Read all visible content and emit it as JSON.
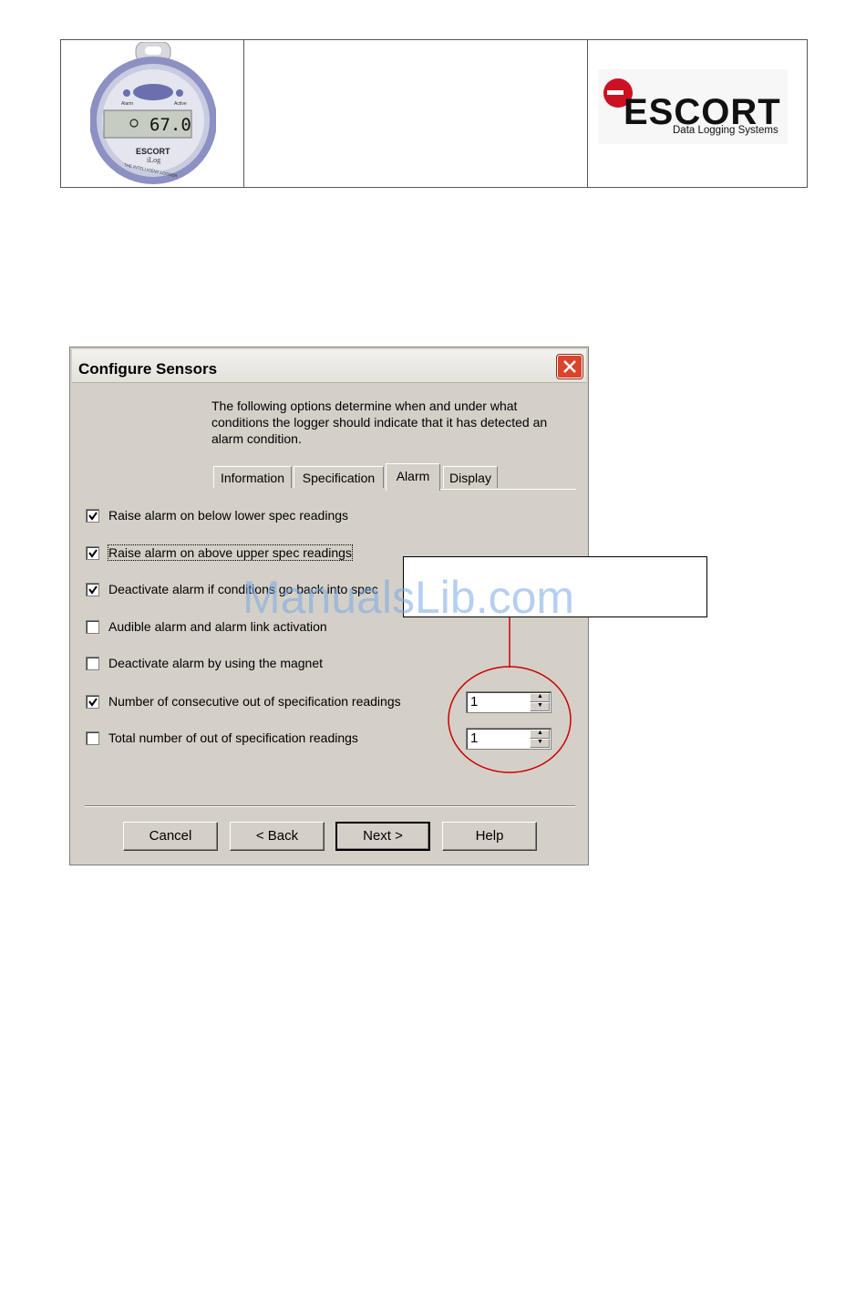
{
  "header": {
    "device_display": "67.0",
    "device_brand": "ESCORT",
    "device_model": "iLog",
    "device_tagline": "THE INTELLIGENT LOGGER",
    "device_led_left": "Alarm",
    "device_led_right": "Active",
    "logo_name": "ESCORT",
    "logo_subtitle": "Data Logging Systems"
  },
  "dialog": {
    "title": "Configure Sensors",
    "intro": "The following options determine when and under what conditions the logger should indicate that it has detected an alarm condition.",
    "tabs": [
      {
        "label": "Information",
        "active": false
      },
      {
        "label": "Specification",
        "active": false
      },
      {
        "label": "Alarm",
        "active": true
      },
      {
        "label": "Display",
        "active": false
      }
    ],
    "options": [
      {
        "label": "Raise alarm on below lower spec readings",
        "checked": true
      },
      {
        "label": "Raise alarm on above upper spec readings",
        "checked": true
      },
      {
        "label": "Deactivate alarm if conditions go back into spec",
        "checked": true
      },
      {
        "label": "Audible alarm and alarm link activation",
        "checked": false
      },
      {
        "label": "Deactivate alarm by using the magnet",
        "checked": false
      },
      {
        "label": "Number of consecutive out of specification readings",
        "checked": true
      },
      {
        "label": "Total number of out of specification readings",
        "checked": false
      }
    ],
    "consecutive_value": "1",
    "total_value": "1",
    "buttons": {
      "cancel": "Cancel",
      "back": "< Back",
      "next": "Next >",
      "help": "Help"
    }
  },
  "watermark": "ManualsLib.com",
  "colors": {
    "dialog_bg": "#d4d0c8",
    "callout_red": "#cc0000",
    "logo_red": "#cc1122"
  }
}
